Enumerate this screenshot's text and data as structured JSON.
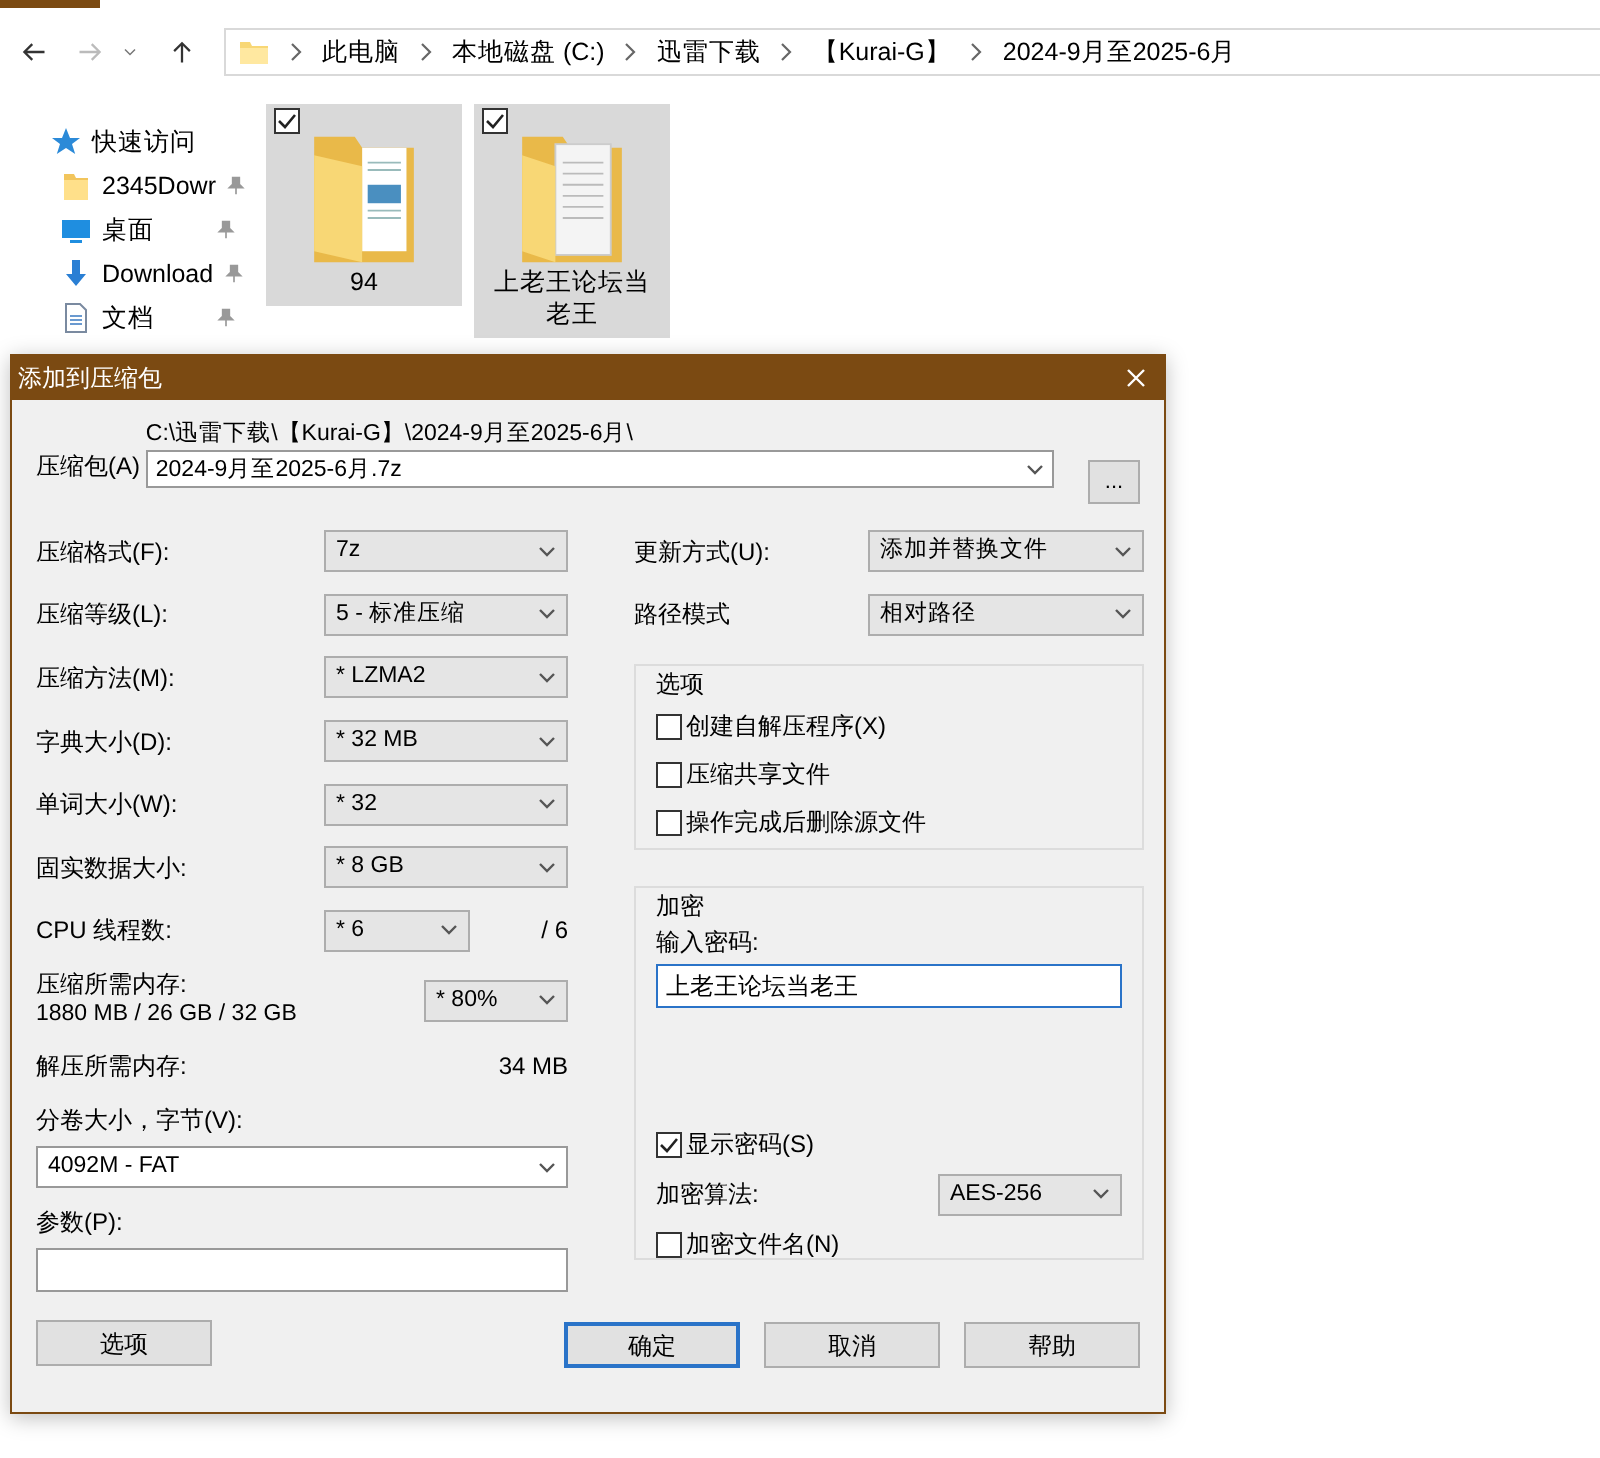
{
  "explorer": {
    "breadcrumb": [
      "此电脑",
      "本地磁盘 (C:)",
      "迅雷下载",
      "【Kurai-G】",
      "2024-9月至2025-6月"
    ],
    "sidebar": [
      {
        "label": "快速访问",
        "kind": "star",
        "pinned": false
      },
      {
        "label": "2345Dowr",
        "kind": "folder",
        "pinned": true
      },
      {
        "label": "桌面",
        "kind": "desktop",
        "pinned": true
      },
      {
        "label": "Download",
        "kind": "download",
        "pinned": true
      },
      {
        "label": "文档",
        "kind": "document",
        "pinned": true
      }
    ],
    "files": [
      {
        "name": "94",
        "checked": true,
        "selected": true,
        "kind": "images"
      },
      {
        "name": "上老王论坛当老王",
        "checked": true,
        "selected": true,
        "kind": "papers"
      }
    ]
  },
  "dialog": {
    "title": "添加到压缩包",
    "archive": {
      "label": "压缩包(A)",
      "path": "C:\\迅雷下载\\【Kurai-G】\\2024-9月至2025-6月\\",
      "value": "2024-9月至2025-6月.7z",
      "browse": "..."
    },
    "left": [
      {
        "kind": "select",
        "label": "压缩格式(F):",
        "value": "7z"
      },
      {
        "kind": "select",
        "label": "压缩等级(L):",
        "value": "5 - 标准压缩"
      },
      {
        "kind": "select",
        "label": "压缩方法(M):",
        "value": "* LZMA2"
      },
      {
        "kind": "select",
        "label": "字典大小(D):",
        "value": "* 32 MB"
      },
      {
        "kind": "select",
        "label": "单词大小(W):",
        "value": "* 32"
      },
      {
        "kind": "select",
        "label": "固实数据大小:",
        "value": "* 8 GB"
      },
      {
        "kind": "threads",
        "label": "CPU 线程数:",
        "value": "* 6",
        "suffix": "/ 6"
      },
      {
        "kind": "memory",
        "label": "压缩所需内存:",
        "detail": "1880 MB / 26 GB / 32 GB",
        "value": "* 80%"
      },
      {
        "kind": "info",
        "label": "解压所需内存:",
        "value": "34 MB"
      },
      {
        "kind": "volume",
        "label": "分卷大小，字节(V):",
        "value": "4092M - FAT"
      },
      {
        "kind": "params",
        "label": "参数(P):"
      }
    ],
    "update": {
      "label": "更新方式(U):",
      "value": "添加并替换文件"
    },
    "path_mode": {
      "label": "路径模式",
      "value": "相对路径"
    },
    "options": {
      "title": "选项",
      "items": [
        {
          "label": "创建自解压程序(X)",
          "checked": false
        },
        {
          "label": "压缩共享文件",
          "checked": false
        },
        {
          "label": "操作完成后删除源文件",
          "checked": false
        }
      ]
    },
    "encryption": {
      "title": "加密",
      "password_label": "输入密码:",
      "password": "上老王论坛当老王",
      "show_password": {
        "label": "显示密码(S)",
        "checked": true
      },
      "method_label": "加密算法:",
      "method": "AES-256",
      "encrypt_names": {
        "label": "加密文件名(N)",
        "checked": false
      }
    },
    "options_button": "选项",
    "buttons": [
      {
        "label": "确定",
        "default": true
      },
      {
        "label": "取消",
        "default": false
      },
      {
        "label": "帮助",
        "default": false
      }
    ]
  }
}
